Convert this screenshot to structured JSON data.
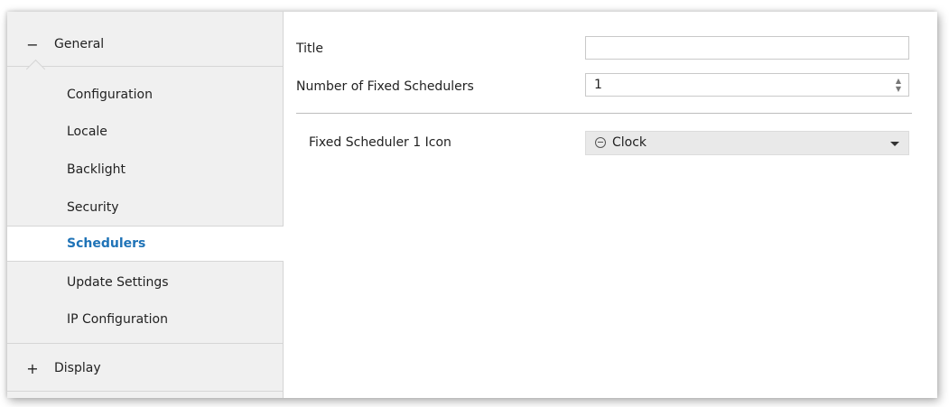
{
  "sidebar": {
    "general": {
      "sign": "−",
      "label": "General"
    },
    "items": [
      {
        "label": "Configuration"
      },
      {
        "label": "Locale"
      },
      {
        "label": "Backlight"
      },
      {
        "label": "Security"
      },
      {
        "label": "Schedulers"
      },
      {
        "label": "Update Settings"
      },
      {
        "label": "IP Configuration"
      }
    ],
    "display": {
      "sign": "+",
      "label": "Display"
    }
  },
  "main": {
    "title": {
      "label": "Title",
      "value": ""
    },
    "fixed_count": {
      "label": "Number of Fixed Schedulers",
      "value": "1"
    },
    "icon_select": {
      "label": "Fixed Scheduler 1 Icon",
      "icon": "clock-icon",
      "value": "Clock"
    }
  },
  "colors": {
    "active": "#1f73b7",
    "sidebar_bg": "#f0f0f0"
  }
}
